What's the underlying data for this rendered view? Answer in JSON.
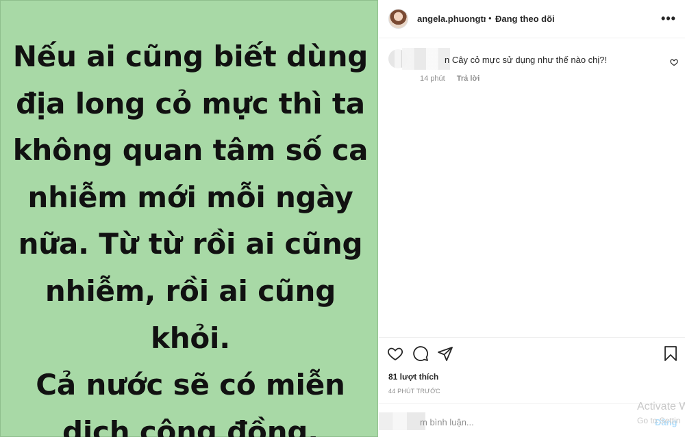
{
  "post": {
    "text_lines": [
      "Nếu ai cũng biết dùng",
      "địa long cỏ mực thì ta",
      "không quan tâm số ca",
      "nhiễm mới mỗi ngày",
      "nữa. Từ từ rồi ai cũng",
      "nhiễm, rồi ai cũng khỏi.",
      "Cả nước sẽ có miễn",
      "dịch cộng đồng."
    ],
    "background_color": "#a8d9a6"
  },
  "header": {
    "username": "angela.phuongtri",
    "dot": "•",
    "follow_status": "Đang theo dõi",
    "more_icon": "more-horizontal-icon"
  },
  "comments": [
    {
      "text": "n Cây cỏ mực sử dụng như thế nào chị?!",
      "time": "14 phút",
      "reply": "Trả lời"
    }
  ],
  "actions": {
    "like_icon": "heart-icon",
    "comment_icon": "comment-icon",
    "share_icon": "send-icon",
    "save_icon": "bookmark-icon"
  },
  "likes": "81 lượt thích",
  "time_ago": "44 PHÚT TRƯỚC",
  "add_comment": {
    "placeholder": "m bình luận...",
    "post_label": "Đăng"
  },
  "watermark": {
    "line1": "Activate W",
    "line2": "Go to Settin"
  }
}
